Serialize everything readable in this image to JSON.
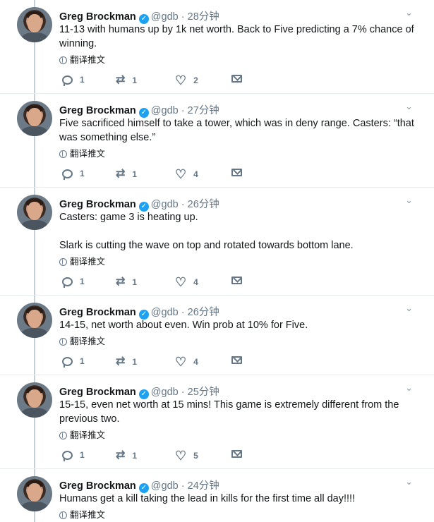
{
  "author": {
    "name": "Greg Brockman",
    "handle": "@gdb",
    "separator": "·"
  },
  "translate_label": "翻译推文",
  "tweets": [
    {
      "time": "28分钟",
      "text": "11-13 with humans up by 1k net worth. Back to Five predicting a 7% chance of winning.",
      "replies": "1",
      "retweets": "1",
      "likes": "2"
    },
    {
      "time": "27分钟",
      "text": "Five sacrificed himself to take a tower, which was in deny range. Casters: “that was something else.”",
      "replies": "1",
      "retweets": "1",
      "likes": "4"
    },
    {
      "time": "26分钟",
      "text": "Casters: game 3 is heating up.\n\nSlark is cutting the wave on top and rotated towards bottom lane.",
      "replies": "1",
      "retweets": "1",
      "likes": "4"
    },
    {
      "time": "26分钟",
      "text": "14-15, net worth about even. Win prob at 10% for Five.",
      "replies": "1",
      "retweets": "1",
      "likes": "4"
    },
    {
      "time": "25分钟",
      "text": "15-15, even net worth at 15 mins! This game is extremely different from the previous two.",
      "replies": "1",
      "retweets": "1",
      "likes": "5"
    },
    {
      "time": "24分钟",
      "text": "Humans get a kill taking the lead in kills for the first time all day!!!!"
    }
  ]
}
